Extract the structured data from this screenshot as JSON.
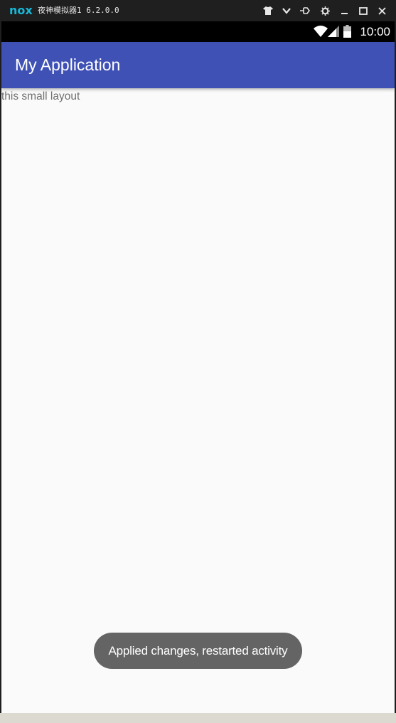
{
  "emulator": {
    "logo_text": "nox",
    "title": "夜神模拟器1 6.2.0.0",
    "buttons": [
      "shirt-icon",
      "chevron-down-icon",
      "pin-icon",
      "gear-icon",
      "minimize-icon",
      "maximize-icon",
      "close-icon"
    ],
    "logo_color": "#16b8d8"
  },
  "statusbar": {
    "time": "10:00",
    "icons": [
      "wifi-icon",
      "signal-icon",
      "battery-icon"
    ]
  },
  "appbar": {
    "title": "My Application",
    "color": "#3f51b5"
  },
  "content": {
    "text": "this small layout"
  },
  "toast": {
    "message": "Applied changes, restarted activity"
  }
}
